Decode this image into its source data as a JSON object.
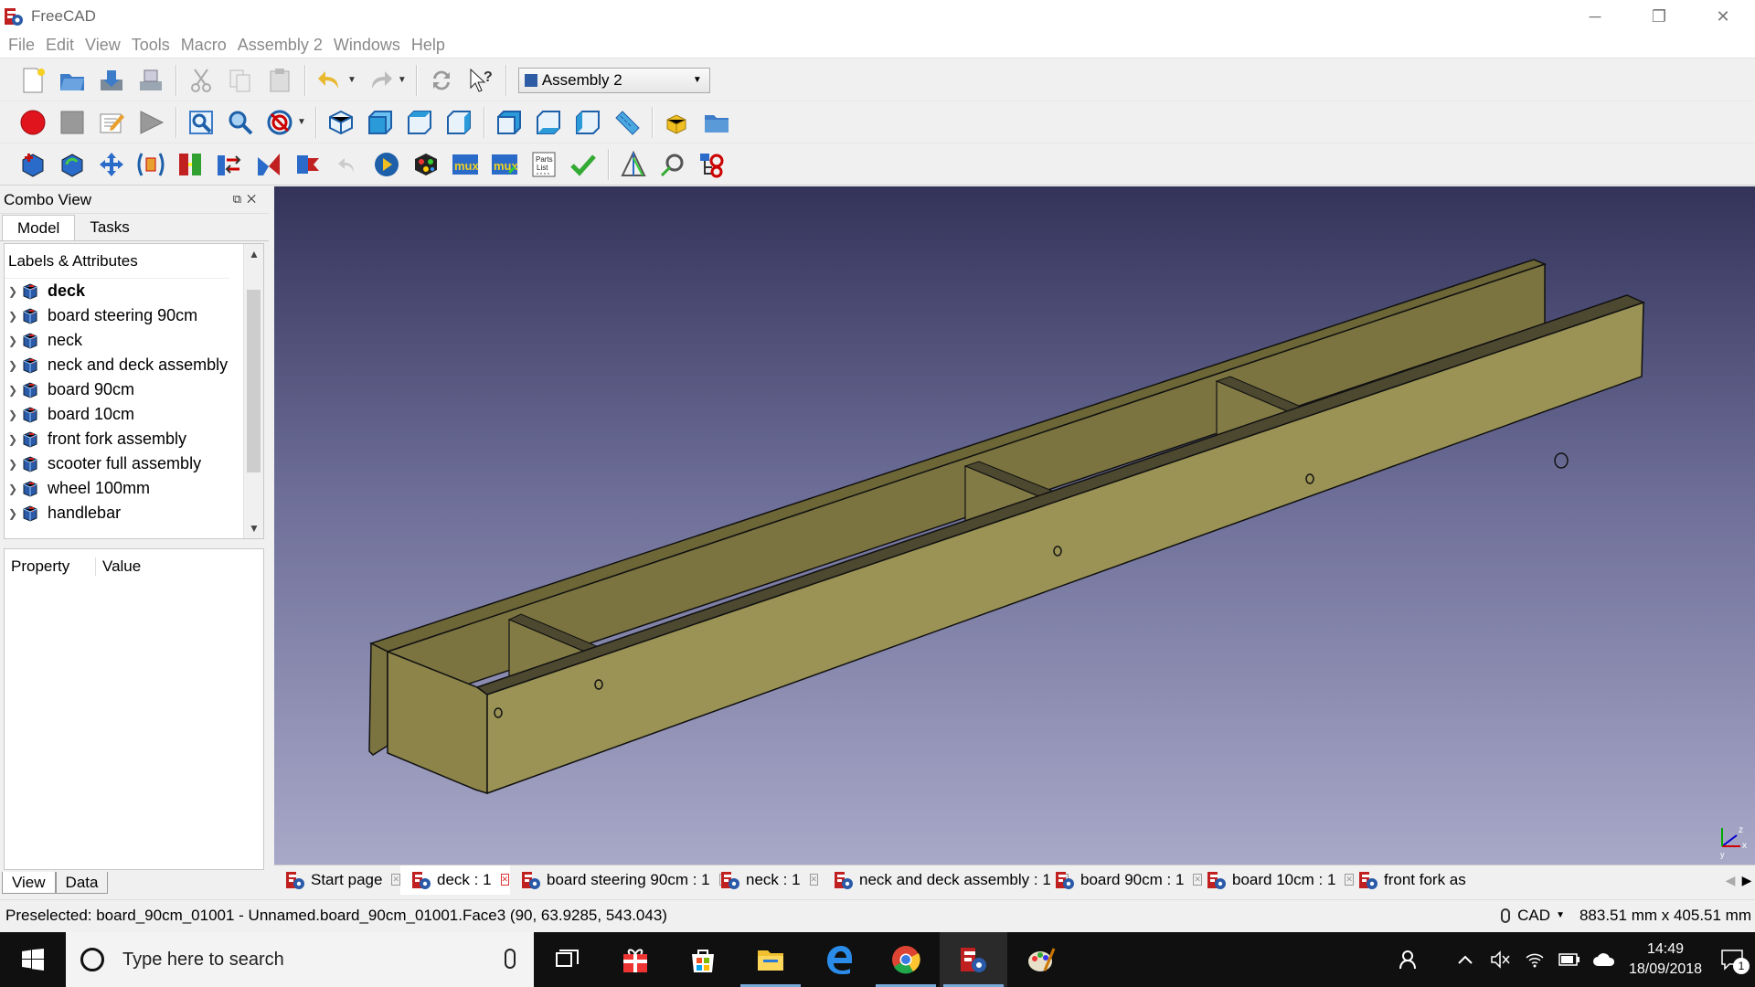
{
  "window": {
    "title": "FreeCAD",
    "minimize_glyph": "─",
    "restore_glyph": "❐",
    "close_glyph": "✕"
  },
  "menu": [
    "File",
    "Edit",
    "View",
    "Tools",
    "Macro",
    "Assembly 2",
    "Windows",
    "Help"
  ],
  "workbench": {
    "selected": "Assembly 2"
  },
  "combo_view": {
    "title": "Combo View",
    "tabs": [
      "Model",
      "Tasks"
    ],
    "tree_header": "Labels & Attributes",
    "items": [
      {
        "label": "deck",
        "bold": true
      },
      {
        "label": "board steering 90cm"
      },
      {
        "label": "neck"
      },
      {
        "label": "neck and deck assembly"
      },
      {
        "label": "board 90cm"
      },
      {
        "label": "board 10cm"
      },
      {
        "label": "front fork assembly"
      },
      {
        "label": "scooter full assembly"
      },
      {
        "label": "wheel 100mm"
      },
      {
        "label": "handlebar"
      }
    ],
    "property_header": "Property",
    "value_header": "Value",
    "bottom_tabs": [
      "View",
      "Data"
    ]
  },
  "doc_tabs": [
    {
      "label": "Start page",
      "active": false
    },
    {
      "label": "deck : 1",
      "active": true
    },
    {
      "label": "board steering 90cm : 1",
      "active": false
    },
    {
      "label": "neck : 1",
      "active": false
    },
    {
      "label": "neck and deck assembly : 1",
      "active": false
    },
    {
      "label": "board 90cm : 1",
      "active": false
    },
    {
      "label": "board 10cm : 1",
      "active": false
    },
    {
      "label": "front fork as",
      "active": false
    }
  ],
  "status": {
    "preselected": "Preselected: board_90cm_01001 - Unnamed.board_90cm_01001.Face3 (90, 63.9285, 543.043)",
    "nav_style": "CAD",
    "dimensions": "883.51 mm x 405.51 mm"
  },
  "taskbar": {
    "search_placeholder": "Type here to search",
    "time": "14:49",
    "date": "18/09/2018",
    "notification_count": "1"
  },
  "colors": {
    "wood_top": "#8a8146",
    "wood_side": "#9b9355",
    "wood_dark": "#4a4630",
    "viewport_top": "#33335a",
    "viewport_bottom": "#a8a8c8",
    "record_red": "#e0141c"
  }
}
